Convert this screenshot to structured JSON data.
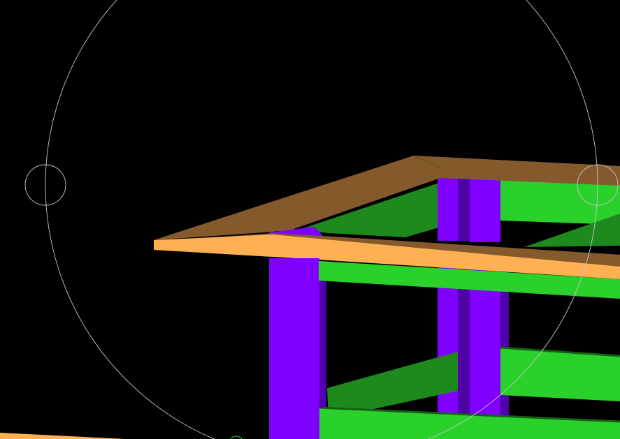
{
  "viewport": {
    "background_color": "#000000",
    "orbit_gizmo_color": "#c8c8c8"
  },
  "colors": {
    "slab_top": "#845a2c",
    "slab_edge": "#ffb052",
    "column_light": "#7f00ff",
    "column_dark": "#4f00a8",
    "beam_light": "#2ad12a",
    "beam_dark": "#1e8a1e",
    "beam_edge": "#146014"
  },
  "icons": {
    "orbit_ring": "arcball-orbit-ring-icon",
    "left_handle": "orbit-handle-icon",
    "right_handle": "orbit-handle-icon"
  }
}
